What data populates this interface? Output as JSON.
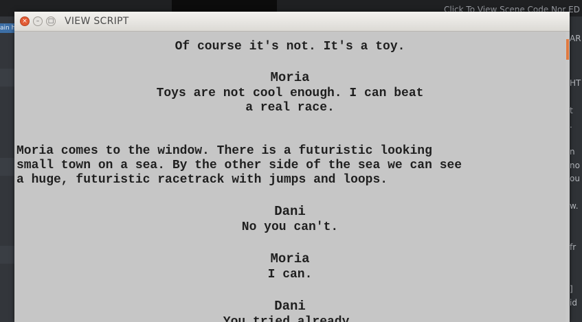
{
  "background": {
    "hint_text": "Click To View Scene Code Nor ED",
    "left_tab_text": "ain h",
    "right_fragments": [
      "AR",
      "HT",
      "t",
      ".",
      "n",
      "no",
      "ou",
      "w.",
      "fr",
      "]",
      "id"
    ]
  },
  "dialog": {
    "title": "VIEW SCRIPT",
    "buttons": {
      "close": "×",
      "minimize": "–",
      "maximize": "□"
    }
  },
  "script": {
    "top_cut_line": "Of course it's not. It's a toy.",
    "block1": {
      "character": "Moria",
      "dialogue": [
        "Toys are not cool enough. I can beat",
        "a real race."
      ]
    },
    "action": [
      "Moria comes to the window. There is a futuristic looking",
      "small town on a sea. By the other side of the sea we can see",
      "a huge, futuristic racetrack with jumps and loops."
    ],
    "block2": {
      "character": "Dani",
      "dialogue": "No you can't."
    },
    "block3": {
      "character": "Moria",
      "dialogue": "I can."
    },
    "block4": {
      "character": "Dani",
      "dialogue": "You tried already."
    }
  },
  "colors": {
    "page_background": "#c6c6c6",
    "close_button": "#e25c35",
    "scroll_thumb": "#e0793f"
  }
}
